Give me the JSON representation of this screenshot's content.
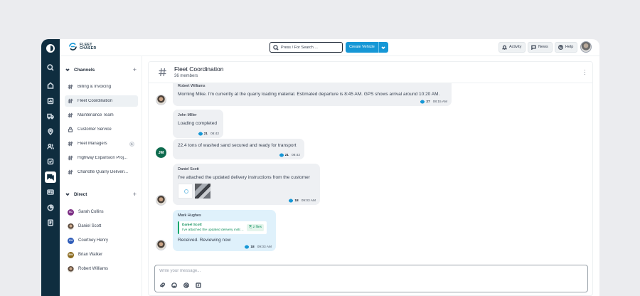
{
  "brand": {
    "line1": "FLEET",
    "line2": "CHASER"
  },
  "topbar": {
    "search_placeholder": "Press / For Search ...",
    "create_label": "Create Vehicle",
    "activity_label": "Activity",
    "news_label": "News",
    "help_label": "Help"
  },
  "sidebar": {
    "channels_title": "Channels",
    "channels": [
      {
        "label": "Billing & Invoicing",
        "icon": "hash-icon"
      },
      {
        "label": "Fleet Coordination",
        "icon": "hash-icon",
        "active": true
      },
      {
        "label": "Maintenance Team",
        "icon": "hash-icon"
      },
      {
        "label": "Customer Service",
        "icon": "lock-icon"
      },
      {
        "label": "Fleet Managers",
        "icon": "hash-icon",
        "badge": "1"
      },
      {
        "label": "Highway Expansion Proj...",
        "icon": "hash-icon"
      },
      {
        "label": "Charlotte Quarry Deliveri...",
        "icon": "hash-icon"
      }
    ],
    "direct_title": "Direct",
    "direct": [
      {
        "name": "Sarah Collins",
        "initials": "SC",
        "color": "#7b2d83"
      },
      {
        "name": "Daniel Scott",
        "initials": "",
        "photo": true
      },
      {
        "name": "Courtney Henry",
        "initials": "CH",
        "color": "#2d5bb8"
      },
      {
        "name": "Brian Walker",
        "initials": "BW",
        "color": "#8a6a1e"
      },
      {
        "name": "Robert Williams",
        "initials": "",
        "photo": true
      }
    ]
  },
  "channel": {
    "title": "Fleet Coordination",
    "members": "36 members"
  },
  "messages": [
    {
      "sender": "Robert Williams",
      "text": "Morning Mike. I'm currently at the quarry loading material. Estimated departure is 8:45 AM. GPS shows arrival around 10:20 AM.",
      "views": "27",
      "time": "08:15 AM"
    },
    {
      "sender": "John Miller",
      "text": "Loading completed",
      "views": "21",
      "time": "08:42"
    },
    {
      "sender": "",
      "initials": "JM",
      "text": "22.4 tons of washed sand secured and ready for transport",
      "views": "21",
      "time": "08:42"
    },
    {
      "sender": "Daniel Scott",
      "text": "I've attached the updated delivery instructions from the customer",
      "views": "18",
      "time": "09:03 AM"
    },
    {
      "sender": "Mark Hughes",
      "quote_name": "Daniel Scott",
      "quote_text": "I've attached the updated delivery instru...",
      "quote_files": "2 files",
      "text": "Received. Reviewing now",
      "views": "18",
      "time": "09:03 AM"
    }
  ],
  "composer": {
    "placeholder": "Write your message..."
  },
  "colors": {
    "rail": "#0f2d3f",
    "accent": "#1697d6",
    "reply_bubble": "#dff1fb",
    "jm_avatar": "#0e6b4e"
  }
}
